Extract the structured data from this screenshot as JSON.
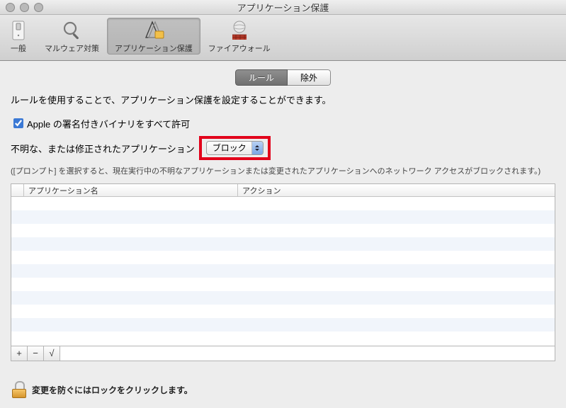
{
  "window": {
    "title": "アプリケーション保護"
  },
  "toolbar": {
    "items": [
      {
        "label": "一般"
      },
      {
        "label": "マルウェア対策"
      },
      {
        "label": "アプリケーション保護"
      },
      {
        "label": "ファイアウォール"
      }
    ]
  },
  "tabs": {
    "rules": "ルール",
    "exclude": "除外"
  },
  "content": {
    "description": "ルールを使用することで、アプリケーション保護を設定することができます。",
    "checkbox_label": "Apple の署名付きバイナリをすべて許可",
    "checkbox_checked": true,
    "unknown_label": "不明な、または修正されたアプリケーション",
    "unknown_action": "ブロック",
    "hint": "([プロンプト] を選択すると、現在実行中の不明なアプリケーションまたは変更されたアプリケーションへのネットワーク アクセスがブロックされます。)"
  },
  "table": {
    "columns": {
      "app": "アプリケーション名",
      "action": "アクション"
    },
    "rows": []
  },
  "footer": {
    "add": "+",
    "remove": "−",
    "apply": "√",
    "lock_text": "変更を防ぐにはロックをクリックします。"
  }
}
